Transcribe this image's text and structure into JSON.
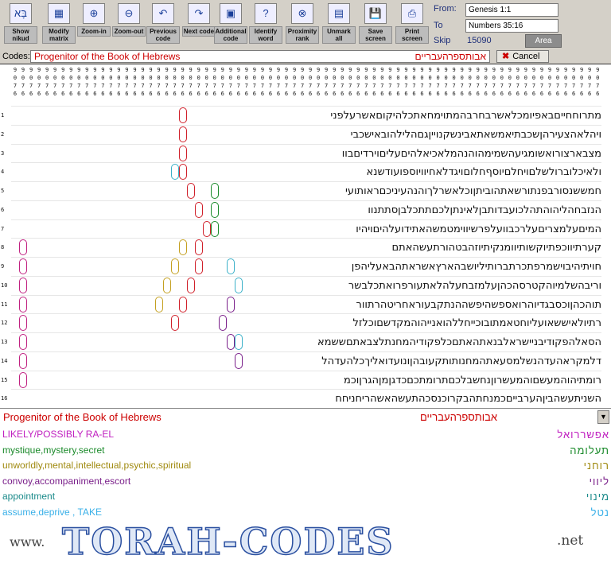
{
  "toolbar": {
    "buttons": [
      {
        "name": "show-nikud-button",
        "label": "Show nikud",
        "glyph": "בָּא"
      },
      {
        "name": "modify-matrix-button",
        "label": "Modify matrix",
        "glyph": "▦"
      },
      {
        "name": "zoom-in-button",
        "label": "Zoom-in",
        "glyph": "⊕"
      },
      {
        "name": "zoom-out-button",
        "label": "Zoom-out",
        "glyph": "⊖"
      },
      {
        "name": "previous-code-button",
        "label": "Previous code",
        "glyph": "↶"
      },
      {
        "name": "next-code-button",
        "label": "Next code",
        "glyph": "↷"
      },
      {
        "name": "additional-code-button",
        "label": "Additional code",
        "glyph": "▣"
      },
      {
        "name": "identify-word-button",
        "label": "Identify word",
        "glyph": "?"
      },
      {
        "name": "proximity-rank-button",
        "label": "Proximity rank",
        "glyph": "⊗"
      },
      {
        "name": "unmark-all-button",
        "label": "Unmark all",
        "glyph": "▤"
      },
      {
        "name": "save-screen-button",
        "label": "Save screen",
        "glyph": "💾"
      },
      {
        "name": "print-screen-button",
        "label": "Print screen",
        "glyph": "⎙"
      }
    ]
  },
  "range": {
    "from_label": "From:",
    "from_value": "Genesis 1:1",
    "to_label": "To",
    "to_value": "Numbers 35:16",
    "skip_label": "Skip",
    "skip_value": "15090",
    "area_label": "Area"
  },
  "codes": {
    "label": "Codes:",
    "selected": "Progenitor of the Book of Hebrews",
    "letters": "אבותספרהעבריים",
    "cancel_label": "Cancel"
  },
  "colnums": [
    "9076",
    "9076",
    "9076",
    "9076",
    "9076",
    "9076",
    "9076",
    "9076",
    "9076",
    "9076",
    "9076",
    "9076",
    "9076",
    "9076",
    "9076",
    "9076",
    "9076",
    "9076",
    "9076",
    "9076",
    "9076",
    "9076",
    "9076",
    "9076",
    "9076",
    "9076",
    "9076",
    "9076",
    "9076",
    "9076",
    "9076",
    "9076",
    "9076",
    "9076",
    "9076",
    "9076",
    "9076",
    "9076",
    "9076",
    "9076",
    "9076",
    "9076",
    "9076",
    "9076",
    "9076",
    "9076",
    "9076",
    "9076",
    "9076",
    "9076",
    "9076",
    "9076",
    "9076",
    "9076",
    "9076",
    "9076",
    "9076",
    "9076",
    "9076",
    "9076",
    "9076",
    "9076",
    "9076",
    "9076",
    "9076",
    "9076",
    "9076",
    "9076",
    "9076",
    "9076",
    "9076",
    "9076",
    "9076",
    "9076"
  ],
  "rows": [
    {
      "n": "1",
      "t": "מתרוחחייםבאפיומכלאשרבחרבהמתוימחאתכלהיקוםאשרעלפני"
    },
    {
      "n": "2",
      "t": "ויהלאהצעירהןשכבתיאמשאתאבינשקנוייןגםהלילהובאישכבי"
    },
    {
      "n": "3",
      "t": "מצבארצורואשומגיעהשמימהוהנהמלאכיאלהיםעליםוירדיםבוו"
    },
    {
      "n": "4",
      "t": "ולאיכלוברולשלםויחלםיוסףחלוםויגדלאחיוויוספועודשנא"
    },
    {
      "n": "5",
      "t": "חמששנסורבפנתורשאתהוביתןוכלאשרלךוהנהעיניכםראותועי"
    },
    {
      "n": "6",
      "t": "הנזבחהליהוהתהלכועבדותבןלאינתןלכםתתכלבןסתתנוו"
    },
    {
      "n": "7",
      "t": "המיםעלמצריםעלרכבוועלפרשיווימטמשהאתידועלהיםויהיו"
    },
    {
      "n": "8",
      "t": "קערתיווכפתיוקשותיוומנקיתיוזהבטהורתעשהאתם"
    },
    {
      "n": "9",
      "t": "חויתיהיבוישמרפתכרתברותיליושבהארץאשראתהבאעליהפן"
    },
    {
      "n": "10",
      "t": "וריבהשלמיוהקטרסהכהןעלמזבחעלהלאתעורפרואתכלבשר"
    },
    {
      "n": "11",
      "t": "תוהכהןוכסבגדיוהרואספשהיפשההנתקבעוראחריטהרתוור"
    },
    {
      "n": "12",
      "t": "רתיולאיששאועליוחטאמתובוכייחללהואנייהוהמקדשםוכלזל"
    },
    {
      "n": "13",
      "t": "הסאלהפקודיבניישראלבנאתהאתםכלפקודיהמחנתלצבאתםששמא"
    },
    {
      "n": "14",
      "t": "דלמקראהעדהנשלמסעאתהמחנותותקעובהןונועדואליךכלהעדהל"
    },
    {
      "n": "15",
      "t": "רומתיהוהמעשםוהמעשרוןנחשבלכםתרומתכםכדגןמןהגרןוכמ"
    },
    {
      "n": "16",
      "t": "השניתעשהביןהערבייםכמנחתהבקרוכנסכהתעשהאשהריחניחח"
    }
  ],
  "marks": [
    {
      "r": 0,
      "c": 52,
      "color": "#d0202a"
    },
    {
      "r": 1,
      "c": 52,
      "color": "#d0202a"
    },
    {
      "r": 2,
      "c": 52,
      "color": "#d0202a"
    },
    {
      "r": 3,
      "c": 52,
      "color": "#d0202a"
    },
    {
      "r": 3,
      "c": 53,
      "color": "#3ab0c8"
    },
    {
      "r": 4,
      "c": 51,
      "color": "#d0202a"
    },
    {
      "r": 4,
      "c": 48,
      "color": "#1a8a2a"
    },
    {
      "r": 5,
      "c": 50,
      "color": "#d0202a"
    },
    {
      "r": 5,
      "c": 48,
      "color": "#1a8a2a"
    },
    {
      "r": 6,
      "c": 49,
      "color": "#d0202a"
    },
    {
      "r": 6,
      "c": 48,
      "color": "#1a8a2a"
    },
    {
      "r": 7,
      "c": 50,
      "color": "#d0202a"
    },
    {
      "r": 7,
      "c": 52,
      "color": "#c4a020"
    },
    {
      "r": 7,
      "c": 72,
      "color": "#c02080"
    },
    {
      "r": 8,
      "c": 50,
      "color": "#d0202a"
    },
    {
      "r": 8,
      "c": 53,
      "color": "#c4a020"
    },
    {
      "r": 8,
      "c": 46,
      "color": "#3ab0c8"
    },
    {
      "r": 8,
      "c": 72,
      "color": "#c02080"
    },
    {
      "r": 9,
      "c": 51,
      "color": "#d0202a"
    },
    {
      "r": 9,
      "c": 54,
      "color": "#c4a020"
    },
    {
      "r": 9,
      "c": 45,
      "color": "#3ab0c8"
    },
    {
      "r": 9,
      "c": 72,
      "color": "#c02080"
    },
    {
      "r": 10,
      "c": 52,
      "color": "#d0202a"
    },
    {
      "r": 10,
      "c": 55,
      "color": "#c4a020"
    },
    {
      "r": 10,
      "c": 46,
      "color": "#7a1f8a"
    },
    {
      "r": 10,
      "c": 72,
      "color": "#c02080"
    },
    {
      "r": 11,
      "c": 53,
      "color": "#d0202a"
    },
    {
      "r": 11,
      "c": 47,
      "color": "#7a1f8a"
    },
    {
      "r": 11,
      "c": 72,
      "color": "#c02080"
    },
    {
      "r": 12,
      "c": 45,
      "color": "#3ab0c8"
    },
    {
      "r": 12,
      "c": 46,
      "color": "#7a1f8a"
    },
    {
      "r": 12,
      "c": 72,
      "color": "#c02080"
    },
    {
      "r": 13,
      "c": 45,
      "color": "#7a1f8a"
    },
    {
      "r": 13,
      "c": 72,
      "color": "#c02080"
    },
    {
      "r": 14,
      "c": 72,
      "color": "#c02080"
    }
  ],
  "search": {
    "text": "Progenitor of the Book of Hebrews",
    "letters": "אבותספרהעבריים"
  },
  "meanings": [
    {
      "text": "LIKELY/POSSIBLY RA-EL",
      "color": "#c020c0",
      "letters": "אפשררואל"
    },
    {
      "text": "mystique,mystery,secret",
      "color": "#1a8a2a",
      "letters": "תעלומה"
    },
    {
      "text": "unworldly,mental,intellectual,psychic,spiritual",
      "color": "#a08a10",
      "letters": "רוחני"
    },
    {
      "text": "convoy,accompaniment,escort",
      "color": "#7a1f8a",
      "letters": "ליווי"
    },
    {
      "text": "appointment",
      "color": "#1a8a8a",
      "letters": "מינוי"
    },
    {
      "text": "assume,deprive , TAKE",
      "color": "#3ab0e8",
      "letters": "נטל"
    }
  ],
  "banner": {
    "www": "www.",
    "main": "TORAH-CODES",
    "net": ".net"
  }
}
